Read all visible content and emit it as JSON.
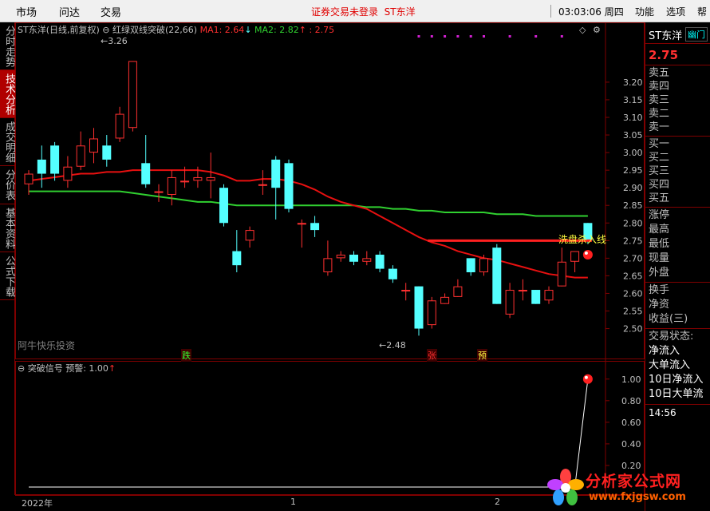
{
  "menu": {
    "items": [
      "市场",
      "问达",
      "交易"
    ],
    "right_items": [
      "功能",
      "选项",
      "帮"
    ],
    "status_message": "证券交易未登录",
    "status_stock": "ST东洋",
    "clock": "03:03:06 周四"
  },
  "sidetabs": [
    "分时走势",
    "技术分析",
    "成交明细",
    "分价表",
    "基本资料",
    "公式下载"
  ],
  "chart_header": {
    "stock": "ST东洋",
    "mode": "(日线,前复权)",
    "indicator": "红绿双线突破(22,66)",
    "ma1": "MA1: 2.64",
    "ma1_arrow": "↓",
    "ma2": "MA2: 2.82",
    "ma2_arrow": "↑",
    "extra": ": 2.75"
  },
  "sub_header": {
    "label": "突破信号",
    "warn": "预警: 1.00",
    "arrow": "↑"
  },
  "annotations": {
    "high": "3.26",
    "low": "2.48",
    "watermark": "阿牛快乐投资",
    "sell_line": "洗盘杀入线",
    "mark_die": "跌",
    "mark_zhang": "张",
    "mark_yu": "预"
  },
  "right_panel": {
    "stock": "ST东洋",
    "tag": "幽门",
    "price": "2.75",
    "order_book": [
      "卖五",
      "卖四",
      "卖三",
      "卖二",
      "卖一",
      "买一",
      "买二",
      "买三",
      "买四",
      "买五"
    ],
    "quote_rows": [
      "涨停",
      "最高",
      "最低",
      "现量",
      "外盘"
    ],
    "extra_rows": [
      "换手",
      "净资",
      "收益(三)"
    ],
    "flow_rows": [
      "交易状态:",
      "净流入",
      "大单流入",
      "10日净流入",
      "10日大单流"
    ],
    "time": "14:56"
  },
  "bottom": {
    "dates": [
      "2022年",
      "1",
      "2"
    ]
  },
  "logo": {
    "text": "分析家公式网",
    "url": "www.fxjgsw.com"
  },
  "colors": {
    "up": "#ff3030",
    "down": "#54ffff",
    "ma_red": "#e81010",
    "ma_green": "#30d030",
    "signal": "#ff2020",
    "grid": "#800000"
  },
  "chart_data": [
    {
      "type": "candlestick",
      "title": "ST东洋 (日线,前复权)",
      "ylim": [
        2.44,
        3.32
      ],
      "y_ticks": [
        3.2,
        3.15,
        3.1,
        3.05,
        3.0,
        2.95,
        2.9,
        2.85,
        2.8,
        2.75,
        2.7,
        2.65,
        2.6,
        2.55,
        2.5
      ],
      "candles": [
        {
          "o": 2.91,
          "c": 2.94,
          "h": 2.95,
          "l": 2.88
        },
        {
          "o": 2.98,
          "c": 2.94,
          "h": 3.02,
          "l": 2.9
        },
        {
          "o": 3.02,
          "c": 2.94,
          "h": 3.03,
          "l": 2.92
        },
        {
          "o": 2.92,
          "c": 2.96,
          "h": 2.99,
          "l": 2.9
        },
        {
          "o": 2.96,
          "c": 3.02,
          "h": 3.06,
          "l": 2.95
        },
        {
          "o": 3.0,
          "c": 3.04,
          "h": 3.07,
          "l": 2.97
        },
        {
          "o": 3.02,
          "c": 2.98,
          "h": 3.05,
          "l": 2.96
        },
        {
          "o": 3.04,
          "c": 3.11,
          "h": 3.13,
          "l": 3.03
        },
        {
          "o": 3.07,
          "c": 3.26,
          "h": 3.26,
          "l": 3.06
        },
        {
          "o": 2.97,
          "c": 2.91,
          "h": 3.05,
          "l": 2.9
        },
        {
          "o": 2.89,
          "c": 2.89,
          "h": 2.91,
          "l": 2.86
        },
        {
          "o": 2.88,
          "c": 2.93,
          "h": 2.95,
          "l": 2.85
        },
        {
          "o": 2.92,
          "c": 2.92,
          "h": 2.96,
          "l": 2.9
        },
        {
          "o": 2.92,
          "c": 2.93,
          "h": 2.96,
          "l": 2.9
        },
        {
          "o": 2.92,
          "c": 2.93,
          "h": 3.0,
          "l": 2.87
        },
        {
          "o": 2.9,
          "c": 2.8,
          "h": 2.91,
          "l": 2.79
        },
        {
          "o": 2.72,
          "c": 2.68,
          "h": 2.78,
          "l": 2.66
        },
        {
          "o": 2.75,
          "c": 2.78,
          "h": 2.79,
          "l": 2.73
        },
        {
          "o": 2.91,
          "c": 2.91,
          "h": 2.95,
          "l": 2.88
        },
        {
          "o": 2.98,
          "c": 2.9,
          "h": 2.99,
          "l": 2.81
        },
        {
          "o": 2.97,
          "c": 2.84,
          "h": 2.98,
          "l": 2.83
        },
        {
          "o": 2.8,
          "c": 2.8,
          "h": 2.81,
          "l": 2.73
        },
        {
          "o": 2.8,
          "c": 2.78,
          "h": 2.82,
          "l": 2.76
        },
        {
          "o": 2.66,
          "c": 2.7,
          "h": 2.75,
          "l": 2.65
        },
        {
          "o": 2.7,
          "c": 2.71,
          "h": 2.72,
          "l": 2.69
        },
        {
          "o": 2.71,
          "c": 2.69,
          "h": 2.72,
          "l": 2.68
        },
        {
          "o": 2.69,
          "c": 2.7,
          "h": 2.72,
          "l": 2.68
        },
        {
          "o": 2.71,
          "c": 2.67,
          "h": 2.72,
          "l": 2.66
        },
        {
          "o": 2.67,
          "c": 2.64,
          "h": 2.68,
          "l": 2.63
        },
        {
          "o": 2.61,
          "c": 2.61,
          "h": 2.63,
          "l": 2.58
        },
        {
          "o": 2.62,
          "c": 2.5,
          "h": 2.62,
          "l": 2.48
        },
        {
          "o": 2.51,
          "c": 2.58,
          "h": 2.59,
          "l": 2.5
        },
        {
          "o": 2.57,
          "c": 2.59,
          "h": 2.6,
          "l": 2.57
        },
        {
          "o": 2.59,
          "c": 2.62,
          "h": 2.64,
          "l": 2.59
        },
        {
          "o": 2.7,
          "c": 2.66,
          "h": 2.7,
          "l": 2.65
        },
        {
          "o": 2.66,
          "c": 2.7,
          "h": 2.71,
          "l": 2.65
        },
        {
          "o": 2.73,
          "c": 2.57,
          "h": 2.74,
          "l": 2.57
        },
        {
          "o": 2.54,
          "c": 2.61,
          "h": 2.63,
          "l": 2.53
        },
        {
          "o": 2.61,
          "c": 2.61,
          "h": 2.64,
          "l": 2.58
        },
        {
          "o": 2.61,
          "c": 2.57,
          "h": 2.61,
          "l": 2.57
        },
        {
          "o": 2.58,
          "c": 2.61,
          "h": 2.62,
          "l": 2.57
        },
        {
          "o": 2.62,
          "c": 2.69,
          "h": 2.73,
          "l": 2.62
        },
        {
          "o": 2.69,
          "c": 2.72,
          "h": 2.72,
          "l": 2.66
        },
        {
          "o": 2.8,
          "c": 2.75,
          "h": 2.8,
          "l": 2.74
        }
      ],
      "ma_red": [
        2.92,
        2.925,
        2.93,
        2.935,
        2.94,
        2.94,
        2.945,
        2.945,
        2.95,
        2.95,
        2.95,
        2.95,
        2.95,
        2.95,
        2.945,
        2.935,
        2.92,
        2.92,
        2.925,
        2.925,
        2.92,
        2.91,
        2.895,
        2.875,
        2.86,
        2.85,
        2.84,
        2.82,
        2.8,
        2.78,
        2.76,
        2.745,
        2.735,
        2.72,
        2.71,
        2.7,
        2.695,
        2.685,
        2.675,
        2.665,
        2.655,
        2.65,
        2.645,
        2.645
      ],
      "ma_green": [
        2.89,
        2.89,
        2.89,
        2.89,
        2.89,
        2.89,
        2.89,
        2.89,
        2.885,
        2.88,
        2.875,
        2.87,
        2.865,
        2.86,
        2.86,
        2.855,
        2.85,
        2.85,
        2.85,
        2.85,
        2.85,
        2.85,
        2.85,
        2.85,
        2.85,
        2.85,
        2.845,
        2.845,
        2.84,
        2.84,
        2.835,
        2.835,
        2.83,
        2.83,
        2.83,
        2.83,
        2.825,
        2.825,
        2.825,
        2.82,
        2.82,
        2.82,
        2.82,
        2.82
      ],
      "sell_line": {
        "value": 2.75,
        "from": 31,
        "to": 43
      }
    },
    {
      "type": "line",
      "title": "突破信号",
      "ylim": [
        0,
        1.05
      ],
      "y_ticks": [
        1.0,
        0.8,
        0.6,
        0.4,
        0.2
      ],
      "values": [
        0,
        0,
        0,
        0,
        0,
        0,
        0,
        0,
        0,
        0,
        0,
        0,
        0,
        0,
        0,
        0,
        0,
        0,
        0,
        0,
        0,
        0,
        0,
        0,
        0,
        0,
        0,
        0,
        0,
        0,
        0,
        0,
        0,
        0,
        0,
        0,
        0,
        0,
        0,
        0,
        0,
        0,
        0,
        1.0
      ]
    }
  ]
}
